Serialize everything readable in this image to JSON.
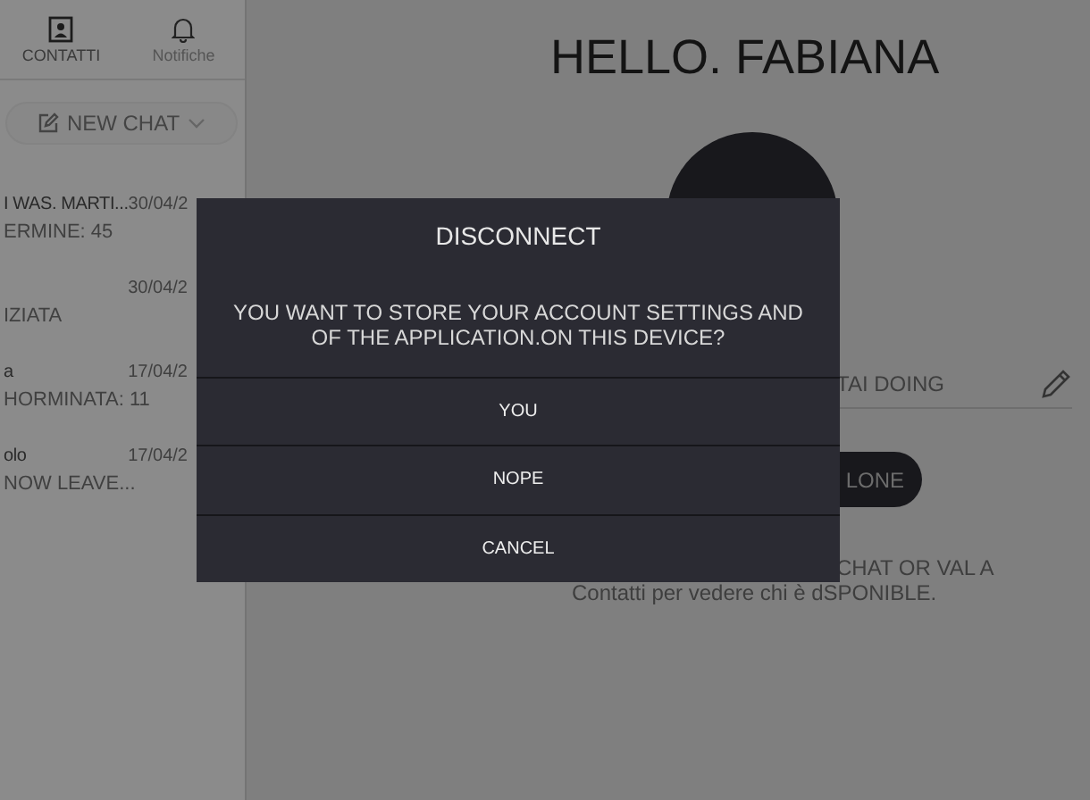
{
  "sidebar": {
    "nav": [
      {
        "label": "CONTATTI",
        "selected": true
      },
      {
        "label": "Notifiche",
        "selected": false
      }
    ],
    "new_chat": {
      "label": "NEW CHAT"
    },
    "chats": [
      {
        "name": "I WAS. MARTI...",
        "date": "30/04/2",
        "preview": "ERMINE: 45"
      },
      {
        "date": "30/04/2",
        "preview": "IZIATA"
      },
      {
        "name": "a",
        "date": "17/04/2",
        "preview": "HORMINATA: 11"
      },
      {
        "name": "olo",
        "date": "17/04/2",
        "preview": "NOW LEAVE..."
      }
    ]
  },
  "main": {
    "greeting": "HELLO. FABIANA",
    "status_field": {
      "value": "TAI DOING"
    },
    "pill_button": "LONE",
    "hint": [
      "CHAT OR VAL A",
      "Contatti per vedere chi è dSPONIBLE."
    ]
  },
  "dialog": {
    "title": "DISCONNECT",
    "message": [
      "YOU WANT TO STORE YOUR ACCOUNT SETTINGS AND",
      "OF THE APPLICATION.ON THIS DEVICE?"
    ],
    "buttons": [
      "YOU",
      "NOPE",
      "CANCEL"
    ]
  }
}
